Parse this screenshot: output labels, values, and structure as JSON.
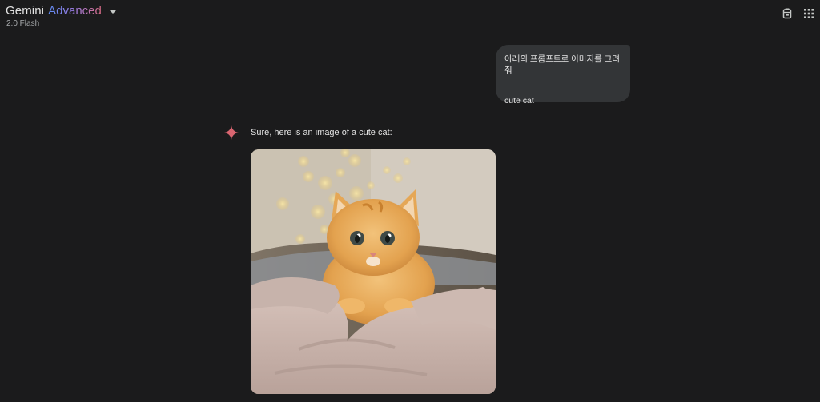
{
  "header": {
    "brand_name": "Gemini",
    "brand_tier": "Advanced",
    "model_version": "2.0 Flash",
    "icons": [
      "temporary-chat-icon",
      "apps-grid-icon"
    ]
  },
  "conversation": {
    "user_message": {
      "line1": "아래의 프롬프트로 이미지를 그려줘",
      "line2": "cute cat"
    },
    "model_response": {
      "text": "Sure, here is an image of a cute cat:",
      "image_subject": "fluffy orange kitten in a basket with a blanket"
    }
  },
  "colors": {
    "background": "#1b1b1c",
    "user_bubble": "#333537",
    "spark": "#d96570",
    "gradient_start": "#5e8cf3",
    "gradient_end": "#d86b84"
  }
}
